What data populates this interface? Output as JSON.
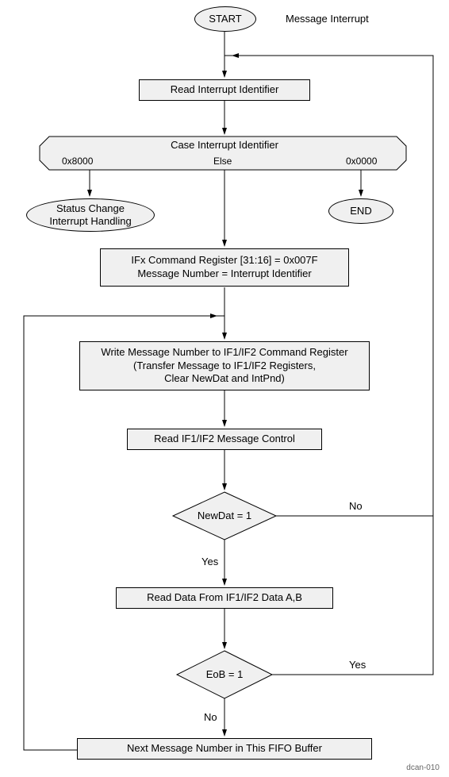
{
  "title_side": "Message Interrupt",
  "start": "START",
  "read_interrupt": "Read Interrupt Identifier",
  "case_title": "Case Interrupt Identifier",
  "case_left": "0x8000",
  "case_mid": "Else",
  "case_right": "0x0000",
  "status_change_l1": "Status Change",
  "status_change_l2": "Interrupt Handling",
  "end": "END",
  "ifx_l1": "IFx Command Register [31:16] = 0x007F",
  "ifx_l2": "Message Number = Interrupt Identifier",
  "write_l1": "Write Message Number to IF1/IF2 Command Register",
  "write_l2": "(Transfer Message to IF1/IF2 Registers,",
  "write_l3": "Clear NewDat and IntPnd)",
  "read_msg_ctrl": "Read IF1/IF2 Message Control",
  "dec_newdat": "NewDat = 1",
  "yes": "Yes",
  "no": "No",
  "read_data": "Read Data From IF1/IF2 Data A,B",
  "dec_eob": "EoB = 1",
  "next_msg": "Next Message Number in This FIFO Buffer",
  "footer": "dcan-010",
  "chart_data": {
    "type": "flowchart",
    "nodes": [
      {
        "id": "start",
        "kind": "terminator",
        "text": "START"
      },
      {
        "id": "title",
        "kind": "label",
        "text": "Message Interrupt"
      },
      {
        "id": "read_int",
        "kind": "process",
        "text": "Read Interrupt Identifier"
      },
      {
        "id": "case",
        "kind": "decision_case",
        "text": "Case Interrupt Identifier",
        "branches": [
          "0x8000",
          "Else",
          "0x0000"
        ]
      },
      {
        "id": "status_change",
        "kind": "terminator",
        "text": "Status Change Interrupt Handling"
      },
      {
        "id": "end",
        "kind": "terminator",
        "text": "END"
      },
      {
        "id": "ifx",
        "kind": "process",
        "text": "IFx Command Register [31:16] = 0x007F; Message Number = Interrupt Identifier"
      },
      {
        "id": "write_cmd",
        "kind": "process",
        "text": "Write Message Number to IF1/IF2 Command Register (Transfer Message to IF1/IF2 Registers, Clear NewDat and IntPnd)"
      },
      {
        "id": "read_ctrl",
        "kind": "process",
        "text": "Read IF1/IF2 Message Control"
      },
      {
        "id": "newdat",
        "kind": "decision",
        "text": "NewDat = 1"
      },
      {
        "id": "read_data",
        "kind": "process",
        "text": "Read Data From IF1/IF2 Data A,B"
      },
      {
        "id": "eob",
        "kind": "decision",
        "text": "EoB = 1"
      },
      {
        "id": "next_msg",
        "kind": "process",
        "text": "Next Message Number in This FIFO Buffer"
      }
    ],
    "edges": [
      {
        "from": "start",
        "to": "read_int"
      },
      {
        "from": "read_int",
        "to": "case"
      },
      {
        "from": "case",
        "to": "status_change",
        "label": "0x8000"
      },
      {
        "from": "case",
        "to": "ifx",
        "label": "Else"
      },
      {
        "from": "case",
        "to": "end",
        "label": "0x0000"
      },
      {
        "from": "ifx",
        "to": "write_cmd"
      },
      {
        "from": "write_cmd",
        "to": "read_ctrl"
      },
      {
        "from": "read_ctrl",
        "to": "newdat"
      },
      {
        "from": "newdat",
        "to": "read_data",
        "label": "Yes"
      },
      {
        "from": "newdat",
        "to": "read_int",
        "label": "No",
        "loop": true
      },
      {
        "from": "read_data",
        "to": "eob"
      },
      {
        "from": "eob",
        "to": "next_msg",
        "label": "No"
      },
      {
        "from": "eob",
        "to": "read_int",
        "label": "Yes",
        "loop": true
      },
      {
        "from": "next_msg",
        "to": "write_cmd",
        "loop": true
      }
    ]
  }
}
